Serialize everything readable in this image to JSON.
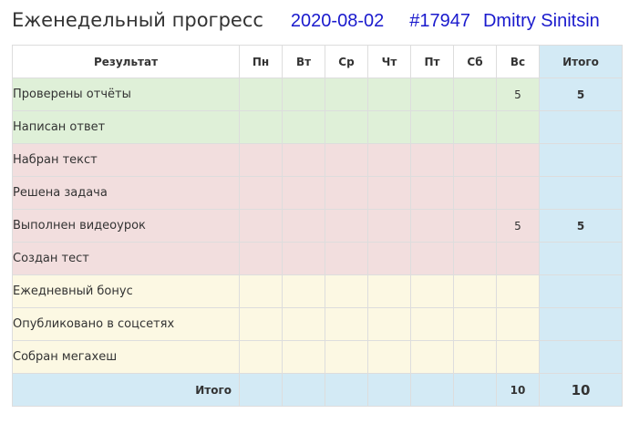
{
  "header": {
    "title": "Еженедельный прогресс",
    "date": "2020-08-02",
    "id": "#17947",
    "user": "Dmitry Sinitsin"
  },
  "table": {
    "columns": {
      "result": "Результат",
      "days": [
        "Пн",
        "Вт",
        "Ср",
        "Чт",
        "Пт",
        "Сб",
        "Вс"
      ],
      "total": "Итого"
    },
    "rows": [
      {
        "label": "Проверены отчёты",
        "group": "green",
        "values": [
          "",
          "",
          "",
          "",
          "",
          "",
          "5"
        ],
        "total": "5"
      },
      {
        "label": "Написан ответ",
        "group": "green",
        "values": [
          "",
          "",
          "",
          "",
          "",
          "",
          ""
        ],
        "total": ""
      },
      {
        "label": "Набран текст",
        "group": "red",
        "values": [
          "",
          "",
          "",
          "",
          "",
          "",
          ""
        ],
        "total": ""
      },
      {
        "label": "Решена задача",
        "group": "red",
        "values": [
          "",
          "",
          "",
          "",
          "",
          "",
          ""
        ],
        "total": ""
      },
      {
        "label": "Выполнен видеоурок",
        "group": "red",
        "values": [
          "",
          "",
          "",
          "",
          "",
          "",
          "5"
        ],
        "total": "5"
      },
      {
        "label": "Создан тест",
        "group": "red",
        "values": [
          "",
          "",
          "",
          "",
          "",
          "",
          ""
        ],
        "total": ""
      },
      {
        "label": "Ежедневный бонус",
        "group": "yellow",
        "values": [
          "",
          "",
          "",
          "",
          "",
          "",
          ""
        ],
        "total": ""
      },
      {
        "label": "Опубликовано в соцсетях",
        "group": "yellow",
        "values": [
          "",
          "",
          "",
          "",
          "",
          "",
          ""
        ],
        "total": ""
      },
      {
        "label": "Собран мегахеш",
        "group": "yellow",
        "values": [
          "",
          "",
          "",
          "",
          "",
          "",
          ""
        ],
        "total": ""
      }
    ],
    "footer": {
      "label": "Итого",
      "values": [
        "",
        "",
        "",
        "",
        "",
        "",
        "10"
      ],
      "total": "10"
    }
  },
  "colors": {
    "green": "#dff0d8",
    "red": "#f2dede",
    "yellow": "#fcf8e3",
    "total": "#d3eaf5",
    "link": "#1a1acd"
  }
}
